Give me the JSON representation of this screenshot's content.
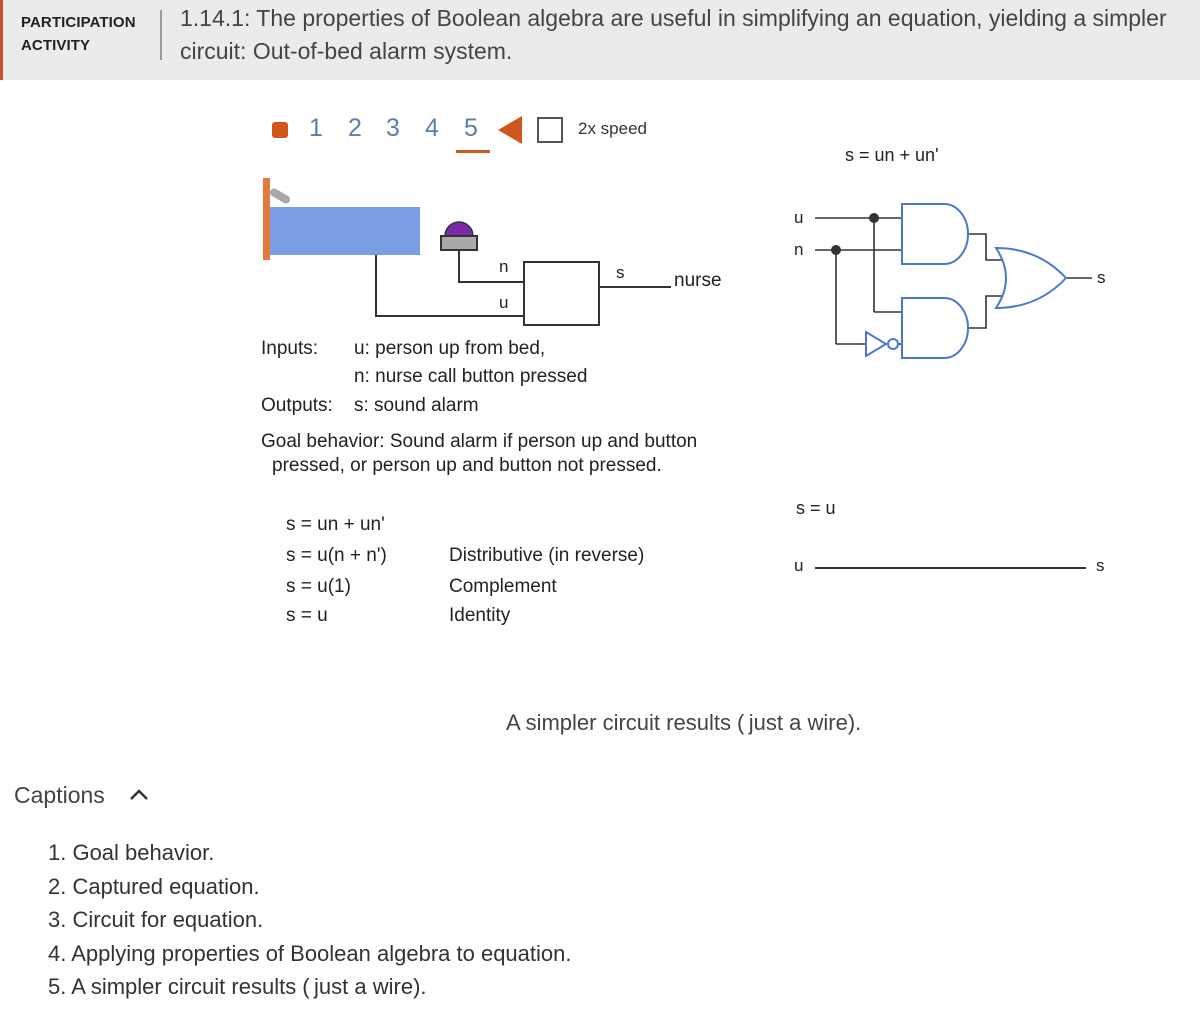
{
  "header": {
    "label_line1": "PARTICIPATION",
    "label_line2": "ACTIVITY",
    "title": "1.14.1: The properties of Boolean algebra are useful in simplifying an equation, yielding a simpler circuit: Out-of-bed alarm system."
  },
  "controls": {
    "steps": [
      "1",
      "2",
      "3",
      "4",
      "5"
    ],
    "active_step": "5",
    "speed_label": "2x speed"
  },
  "system": {
    "n_label": "n",
    "u_label": "u",
    "s_label": "s",
    "nurse_label": "nurse"
  },
  "io": {
    "inputs_label": "Inputs:",
    "input_u": "u: person up from bed,",
    "input_n": "n: nurse call button pressed",
    "outputs_label": "Outputs:",
    "output_s": "s: sound alarm",
    "goal_line1": "Goal behavior: Sound alarm if person up and button",
    "goal_line2": "pressed, or person up and button not pressed."
  },
  "equations": {
    "eq1": "s = un + un'",
    "eq2": "s = u(n + n')",
    "eq3": "s = u(1)",
    "eq4": "s = u",
    "prop2": "Distributive (in reverse)",
    "prop3": "Complement",
    "prop4": "Identity"
  },
  "circuit1": {
    "title": "s = un + un'",
    "in_u": "u",
    "in_n": "n",
    "out_s": "s"
  },
  "circuit2": {
    "title": "s = u",
    "in_u": "u",
    "out_s": "s"
  },
  "caption_main": "A simpler circuit results ( just a wire).",
  "captions": {
    "heading": "Captions",
    "items": [
      "1. Goal behavior.",
      "2. Captured equation.",
      "3. Circuit for equation.",
      "4. Applying properties of Boolean algebra to equation.",
      "5. A simpler circuit results ( just a wire)."
    ]
  },
  "colors": {
    "accent": "#d0561b",
    "step_blue": "#5b7fa6",
    "gate_blue": "#4a78cf",
    "bed_blue": "#7b9de3",
    "bed_orange": "#e07b3c",
    "button_purple": "#7a2aa8"
  }
}
